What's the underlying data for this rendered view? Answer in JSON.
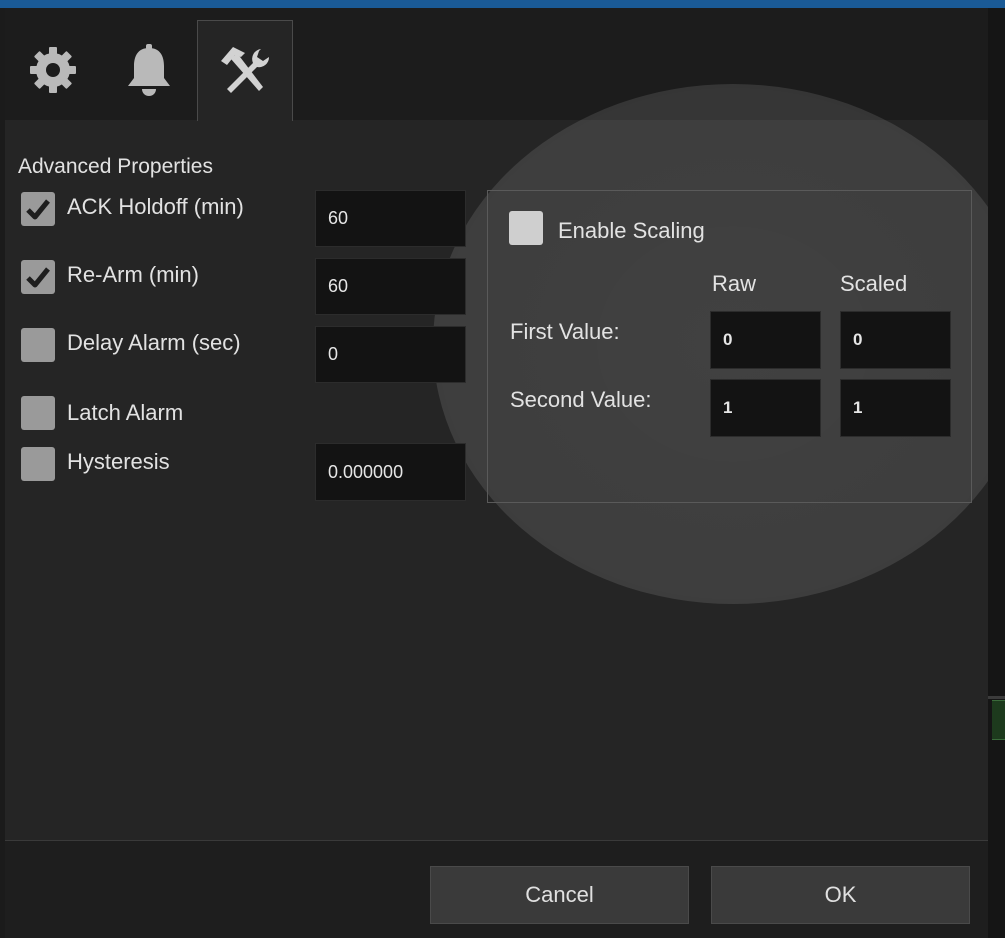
{
  "tabs": [
    {
      "icon": "gear-icon",
      "active": false
    },
    {
      "icon": "bell-icon",
      "active": false
    },
    {
      "icon": "tools-icon",
      "active": true
    }
  ],
  "advanced": {
    "heading": "Advanced Properties",
    "ack_holdoff": {
      "label": "ACK Holdoff (min)",
      "checked": true,
      "value": "60"
    },
    "rearm": {
      "label": "Re-Arm (min)",
      "checked": true,
      "value": "60"
    },
    "delay_alarm": {
      "label": "Delay Alarm (sec)",
      "checked": false,
      "value": "0"
    },
    "latch_alarm": {
      "label": "Latch Alarm",
      "checked": false
    },
    "hysteresis": {
      "label": "Hysteresis",
      "checked": false,
      "value": "0.000000"
    }
  },
  "scaling": {
    "enable_label": "Enable Scaling",
    "enabled": false,
    "raw_header": "Raw",
    "scaled_header": "Scaled",
    "first_label": "First Value:",
    "second_label": "Second Value:",
    "first_raw": "0",
    "first_scaled": "0",
    "second_raw": "1",
    "second_scaled": "1"
  },
  "footer": {
    "cancel_label": "Cancel",
    "ok_label": "OK"
  },
  "colors": {
    "accent_bar": "#1a5a96",
    "background": "#252525",
    "field_background": "#131313"
  }
}
